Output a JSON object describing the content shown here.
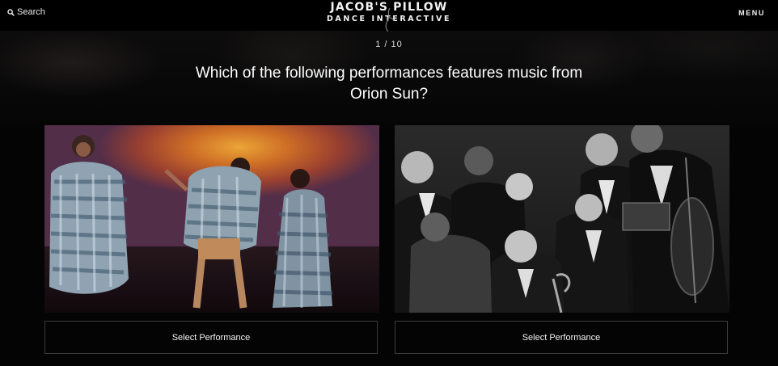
{
  "header": {
    "search_label": "Search",
    "logo_line1": "JACOB'S PILLOW",
    "logo_line2": "DANCE INTERACTIVE",
    "menu_label": "MENU"
  },
  "quiz": {
    "counter": "1 / 10",
    "question": "Which of the following performances features music from Orion Sun?"
  },
  "options": [
    {
      "select_label": "Select Performance"
    },
    {
      "select_label": "Select Performance"
    }
  ],
  "colors": {
    "background": "#040405",
    "text": "#ffffff",
    "button_border": "#3b3b3e"
  },
  "icons": {
    "search": "search-icon"
  }
}
